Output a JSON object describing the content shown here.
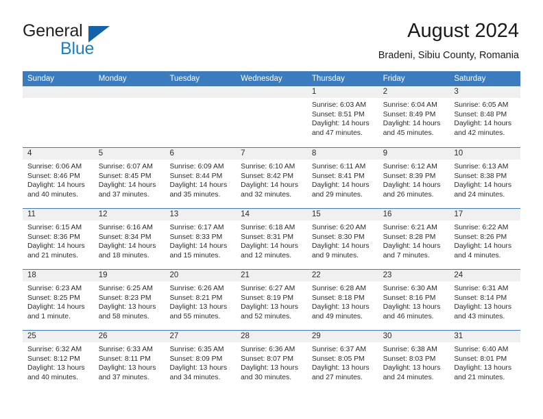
{
  "brand": {
    "word1": "General",
    "word2": "Blue",
    "triangle_color": "#1263ab",
    "blue_color": "#1b7fc4"
  },
  "header": {
    "title": "August 2024",
    "location": "Bradeni, Sibiu County, Romania"
  },
  "theme": {
    "header_blue": "#3a7cbe",
    "number_band": "#f0f0f0",
    "text": "#2b2b2b"
  },
  "weekdays": [
    "Sunday",
    "Monday",
    "Tuesday",
    "Wednesday",
    "Thursday",
    "Friday",
    "Saturday"
  ],
  "weeks": [
    [
      {
        "day": "",
        "sunrise": "",
        "sunset": "",
        "daylight1": "",
        "daylight2": ""
      },
      {
        "day": "",
        "sunrise": "",
        "sunset": "",
        "daylight1": "",
        "daylight2": ""
      },
      {
        "day": "",
        "sunrise": "",
        "sunset": "",
        "daylight1": "",
        "daylight2": ""
      },
      {
        "day": "",
        "sunrise": "",
        "sunset": "",
        "daylight1": "",
        "daylight2": ""
      },
      {
        "day": "1",
        "sunrise": "Sunrise: 6:03 AM",
        "sunset": "Sunset: 8:51 PM",
        "daylight1": "Daylight: 14 hours",
        "daylight2": "and 47 minutes."
      },
      {
        "day": "2",
        "sunrise": "Sunrise: 6:04 AM",
        "sunset": "Sunset: 8:49 PM",
        "daylight1": "Daylight: 14 hours",
        "daylight2": "and 45 minutes."
      },
      {
        "day": "3",
        "sunrise": "Sunrise: 6:05 AM",
        "sunset": "Sunset: 8:48 PM",
        "daylight1": "Daylight: 14 hours",
        "daylight2": "and 42 minutes."
      }
    ],
    [
      {
        "day": "4",
        "sunrise": "Sunrise: 6:06 AM",
        "sunset": "Sunset: 8:46 PM",
        "daylight1": "Daylight: 14 hours",
        "daylight2": "and 40 minutes."
      },
      {
        "day": "5",
        "sunrise": "Sunrise: 6:07 AM",
        "sunset": "Sunset: 8:45 PM",
        "daylight1": "Daylight: 14 hours",
        "daylight2": "and 37 minutes."
      },
      {
        "day": "6",
        "sunrise": "Sunrise: 6:09 AM",
        "sunset": "Sunset: 8:44 PM",
        "daylight1": "Daylight: 14 hours",
        "daylight2": "and 35 minutes."
      },
      {
        "day": "7",
        "sunrise": "Sunrise: 6:10 AM",
        "sunset": "Sunset: 8:42 PM",
        "daylight1": "Daylight: 14 hours",
        "daylight2": "and 32 minutes."
      },
      {
        "day": "8",
        "sunrise": "Sunrise: 6:11 AM",
        "sunset": "Sunset: 8:41 PM",
        "daylight1": "Daylight: 14 hours",
        "daylight2": "and 29 minutes."
      },
      {
        "day": "9",
        "sunrise": "Sunrise: 6:12 AM",
        "sunset": "Sunset: 8:39 PM",
        "daylight1": "Daylight: 14 hours",
        "daylight2": "and 26 minutes."
      },
      {
        "day": "10",
        "sunrise": "Sunrise: 6:13 AM",
        "sunset": "Sunset: 8:38 PM",
        "daylight1": "Daylight: 14 hours",
        "daylight2": "and 24 minutes."
      }
    ],
    [
      {
        "day": "11",
        "sunrise": "Sunrise: 6:15 AM",
        "sunset": "Sunset: 8:36 PM",
        "daylight1": "Daylight: 14 hours",
        "daylight2": "and 21 minutes."
      },
      {
        "day": "12",
        "sunrise": "Sunrise: 6:16 AM",
        "sunset": "Sunset: 8:34 PM",
        "daylight1": "Daylight: 14 hours",
        "daylight2": "and 18 minutes."
      },
      {
        "day": "13",
        "sunrise": "Sunrise: 6:17 AM",
        "sunset": "Sunset: 8:33 PM",
        "daylight1": "Daylight: 14 hours",
        "daylight2": "and 15 minutes."
      },
      {
        "day": "14",
        "sunrise": "Sunrise: 6:18 AM",
        "sunset": "Sunset: 8:31 PM",
        "daylight1": "Daylight: 14 hours",
        "daylight2": "and 12 minutes."
      },
      {
        "day": "15",
        "sunrise": "Sunrise: 6:20 AM",
        "sunset": "Sunset: 8:30 PM",
        "daylight1": "Daylight: 14 hours",
        "daylight2": "and 9 minutes."
      },
      {
        "day": "16",
        "sunrise": "Sunrise: 6:21 AM",
        "sunset": "Sunset: 8:28 PM",
        "daylight1": "Daylight: 14 hours",
        "daylight2": "and 7 minutes."
      },
      {
        "day": "17",
        "sunrise": "Sunrise: 6:22 AM",
        "sunset": "Sunset: 8:26 PM",
        "daylight1": "Daylight: 14 hours",
        "daylight2": "and 4 minutes."
      }
    ],
    [
      {
        "day": "18",
        "sunrise": "Sunrise: 6:23 AM",
        "sunset": "Sunset: 8:25 PM",
        "daylight1": "Daylight: 14 hours",
        "daylight2": "and 1 minute."
      },
      {
        "day": "19",
        "sunrise": "Sunrise: 6:25 AM",
        "sunset": "Sunset: 8:23 PM",
        "daylight1": "Daylight: 13 hours",
        "daylight2": "and 58 minutes."
      },
      {
        "day": "20",
        "sunrise": "Sunrise: 6:26 AM",
        "sunset": "Sunset: 8:21 PM",
        "daylight1": "Daylight: 13 hours",
        "daylight2": "and 55 minutes."
      },
      {
        "day": "21",
        "sunrise": "Sunrise: 6:27 AM",
        "sunset": "Sunset: 8:19 PM",
        "daylight1": "Daylight: 13 hours",
        "daylight2": "and 52 minutes."
      },
      {
        "day": "22",
        "sunrise": "Sunrise: 6:28 AM",
        "sunset": "Sunset: 8:18 PM",
        "daylight1": "Daylight: 13 hours",
        "daylight2": "and 49 minutes."
      },
      {
        "day": "23",
        "sunrise": "Sunrise: 6:30 AM",
        "sunset": "Sunset: 8:16 PM",
        "daylight1": "Daylight: 13 hours",
        "daylight2": "and 46 minutes."
      },
      {
        "day": "24",
        "sunrise": "Sunrise: 6:31 AM",
        "sunset": "Sunset: 8:14 PM",
        "daylight1": "Daylight: 13 hours",
        "daylight2": "and 43 minutes."
      }
    ],
    [
      {
        "day": "25",
        "sunrise": "Sunrise: 6:32 AM",
        "sunset": "Sunset: 8:12 PM",
        "daylight1": "Daylight: 13 hours",
        "daylight2": "and 40 minutes."
      },
      {
        "day": "26",
        "sunrise": "Sunrise: 6:33 AM",
        "sunset": "Sunset: 8:11 PM",
        "daylight1": "Daylight: 13 hours",
        "daylight2": "and 37 minutes."
      },
      {
        "day": "27",
        "sunrise": "Sunrise: 6:35 AM",
        "sunset": "Sunset: 8:09 PM",
        "daylight1": "Daylight: 13 hours",
        "daylight2": "and 34 minutes."
      },
      {
        "day": "28",
        "sunrise": "Sunrise: 6:36 AM",
        "sunset": "Sunset: 8:07 PM",
        "daylight1": "Daylight: 13 hours",
        "daylight2": "and 30 minutes."
      },
      {
        "day": "29",
        "sunrise": "Sunrise: 6:37 AM",
        "sunset": "Sunset: 8:05 PM",
        "daylight1": "Daylight: 13 hours",
        "daylight2": "and 27 minutes."
      },
      {
        "day": "30",
        "sunrise": "Sunrise: 6:38 AM",
        "sunset": "Sunset: 8:03 PM",
        "daylight1": "Daylight: 13 hours",
        "daylight2": "and 24 minutes."
      },
      {
        "day": "31",
        "sunrise": "Sunrise: 6:40 AM",
        "sunset": "Sunset: 8:01 PM",
        "daylight1": "Daylight: 13 hours",
        "daylight2": "and 21 minutes."
      }
    ]
  ]
}
